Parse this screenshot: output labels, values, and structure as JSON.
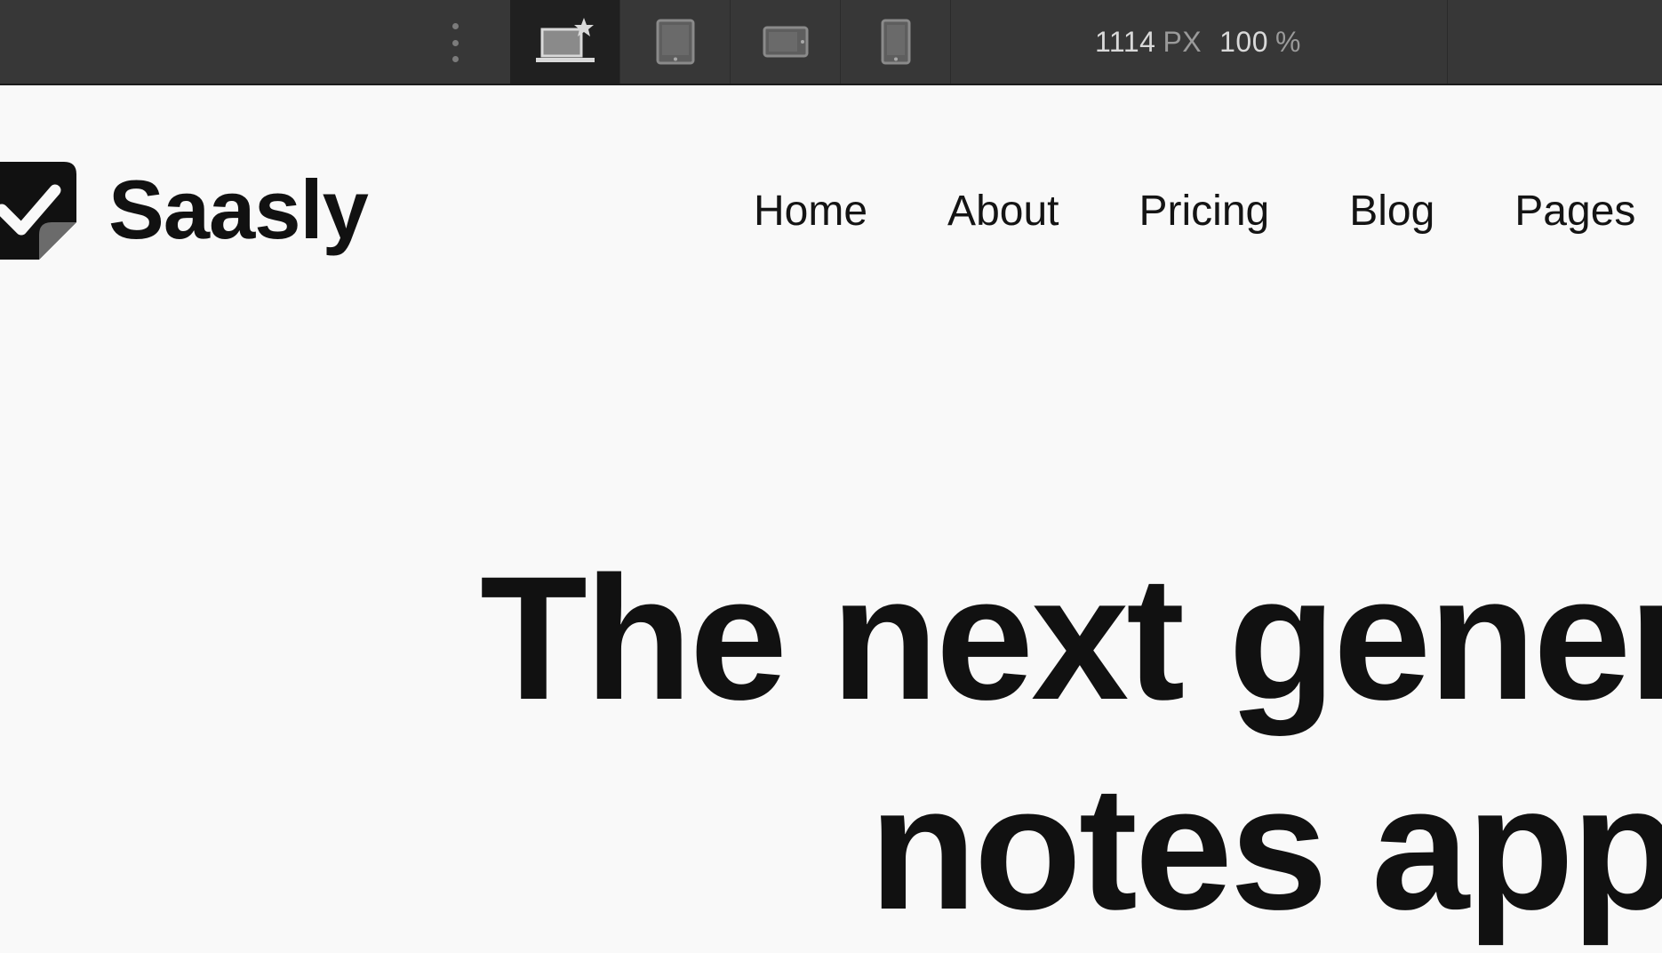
{
  "toolbar": {
    "width_value": "1114",
    "width_unit": "PX",
    "zoom_value": "100",
    "zoom_unit": "%",
    "devices": [
      {
        "name": "desktop",
        "icon": "laptop-star-icon",
        "active": true
      },
      {
        "name": "tablet",
        "icon": "tablet-icon",
        "active": false
      },
      {
        "name": "tablet-landscape",
        "icon": "tablet-landscape-icon",
        "active": false
      },
      {
        "name": "phone",
        "icon": "phone-icon",
        "active": false
      }
    ]
  },
  "site": {
    "brand": "Saasly",
    "nav": [
      "Home",
      "About",
      "Pricing",
      "Blog",
      "Pages"
    ],
    "hero": {
      "line1": "The next generation",
      "line2": "notes app"
    }
  }
}
